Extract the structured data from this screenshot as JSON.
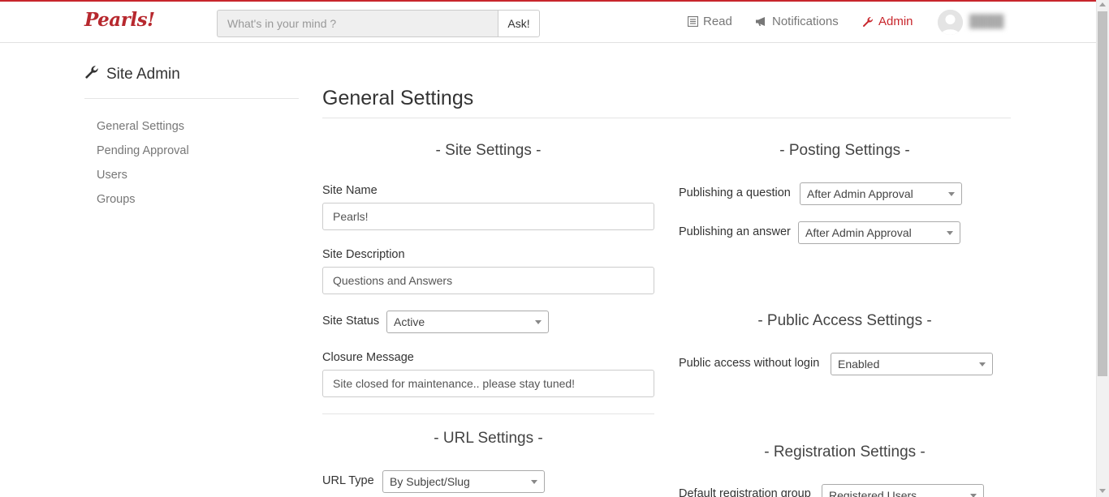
{
  "colors": {
    "accent": "#c8262c",
    "brand": "#b7282e"
  },
  "navbar": {
    "brand": "Pearls!",
    "search_placeholder": "What's in your mind ?",
    "search_value": "",
    "ask_label": "Ask!",
    "read_label": "Read",
    "notifications_label": "Notifications",
    "admin_label": "Admin",
    "username": "████"
  },
  "sidebar": {
    "title": "Site Admin",
    "items": [
      {
        "label": "General Settings"
      },
      {
        "label": "Pending Approval"
      },
      {
        "label": "Users"
      },
      {
        "label": "Groups"
      }
    ]
  },
  "main": {
    "title": "General Settings",
    "site_settings": {
      "heading": "- Site Settings -",
      "site_name_label": "Site Name",
      "site_name_value": "Pearls!",
      "site_description_label": "Site Description",
      "site_description_value": "Questions and Answers",
      "site_status_label": "Site Status",
      "site_status_value": "Active",
      "closure_message_label": "Closure Message",
      "closure_message_value": "Site closed for maintenance.. please stay tuned!"
    },
    "url_settings": {
      "heading": "- URL Settings -",
      "url_type_label": "URL Type",
      "url_type_value": "By Subject/Slug"
    },
    "posting_settings": {
      "heading": "- Posting Settings -",
      "publishing_question_label": "Publishing a question",
      "publishing_question_value": "After Admin Approval",
      "publishing_answer_label": "Publishing an answer",
      "publishing_answer_value": "After Admin Approval"
    },
    "public_access_settings": {
      "heading": "- Public Access Settings -",
      "public_access_label": "Public access without login",
      "public_access_value": "Enabled"
    },
    "registration_settings": {
      "heading": "- Registration Settings -",
      "default_group_label": "Default registration group",
      "default_group_value": "Registered Users"
    }
  }
}
